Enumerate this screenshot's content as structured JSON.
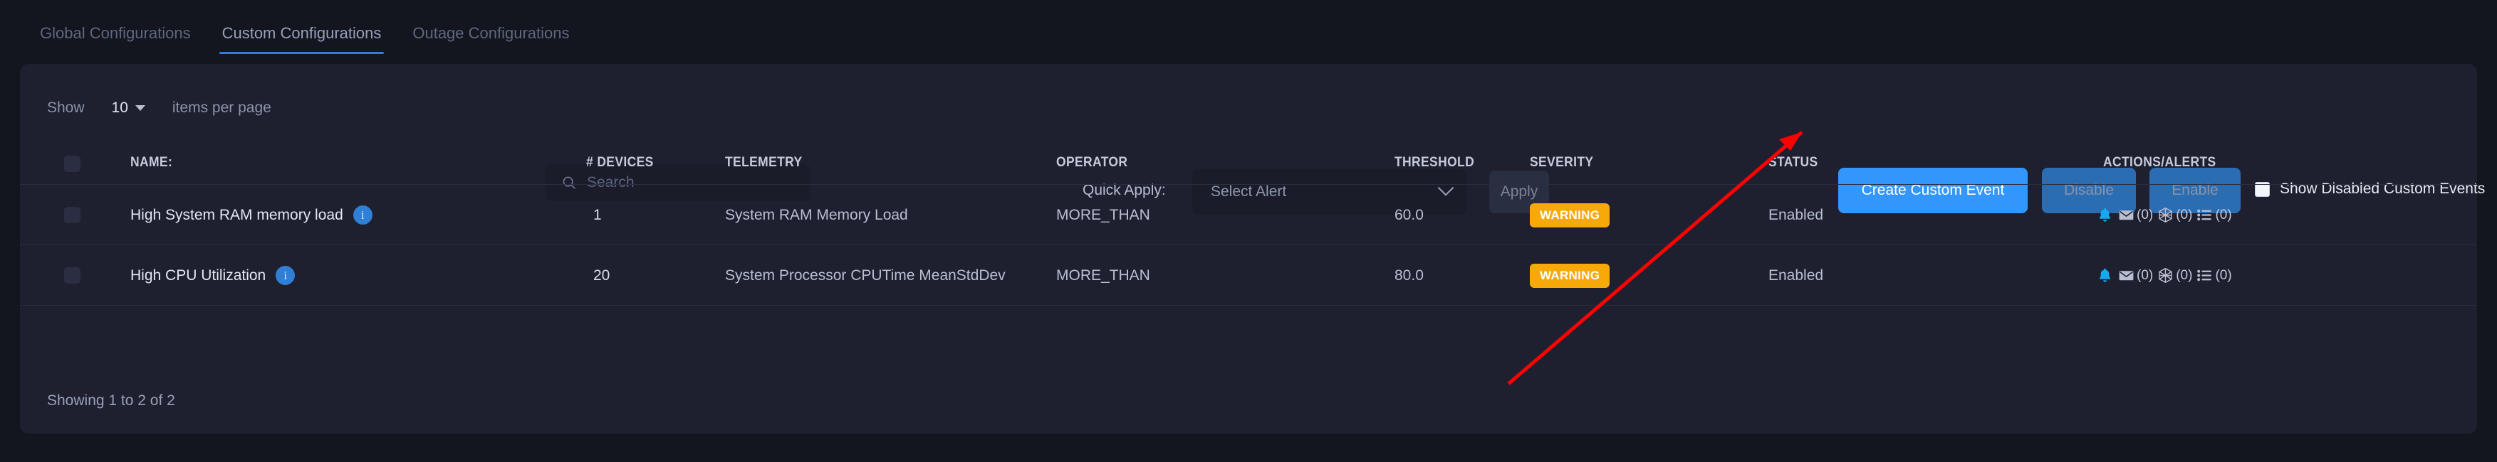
{
  "tabs": [
    {
      "label": "Global Configurations",
      "active": false
    },
    {
      "label": "Custom Configurations",
      "active": true
    },
    {
      "label": "Outage Configurations",
      "active": false
    }
  ],
  "toolbar": {
    "show_label": "Show",
    "page_size": "10",
    "per_page_label": "items per page",
    "search_placeholder": "Search",
    "search_value": "",
    "quick_apply_label": "Quick Apply:",
    "alert_select_value": "Select Alert",
    "apply_label": "Apply",
    "create_label": "Create Custom Event",
    "disable_label": "Disable",
    "enable_label": "Enable",
    "show_disabled_label": "Show Disabled Custom Events",
    "show_disabled_checked": false
  },
  "table": {
    "columns": [
      "NAME:",
      "# DEVICES",
      "TELEMETRY",
      "OPERATOR",
      "THRESHOLD",
      "SEVERITY",
      "STATUS",
      "ACTIONS/ALERTS"
    ],
    "rows": [
      {
        "name": "High System RAM memory load",
        "devices": "1",
        "telemetry": "System RAM Memory Load",
        "operator": "MORE_THAN",
        "threshold": "60.0",
        "severity": "WARNING",
        "status": "Enabled",
        "actions": {
          "bell": "bell-icon",
          "email_count": "(0)",
          "webhook_count": "(0)",
          "list_count": "(0)"
        }
      },
      {
        "name": "High CPU Utilization",
        "devices": "20",
        "telemetry": "System Processor CPUTime MeanStdDev",
        "operator": "MORE_THAN",
        "threshold": "80.0",
        "severity": "WARNING",
        "status": "Enabled",
        "actions": {
          "bell": "bell-icon",
          "email_count": "(0)",
          "webhook_count": "(0)",
          "list_count": "(0)"
        }
      }
    ]
  },
  "footer": {
    "showing": "Showing 1 to 2 of 2"
  },
  "colors": {
    "page_bg": "#13151f",
    "card_bg": "#1e2030",
    "accent_blue": "#3396fa",
    "tab_underline": "#2f7de1",
    "severity_warning": "#f8a90a",
    "secondary_button": "#2a6db3",
    "bell_active": "#18a8f0",
    "annotation_arrow": "#ff0000"
  }
}
